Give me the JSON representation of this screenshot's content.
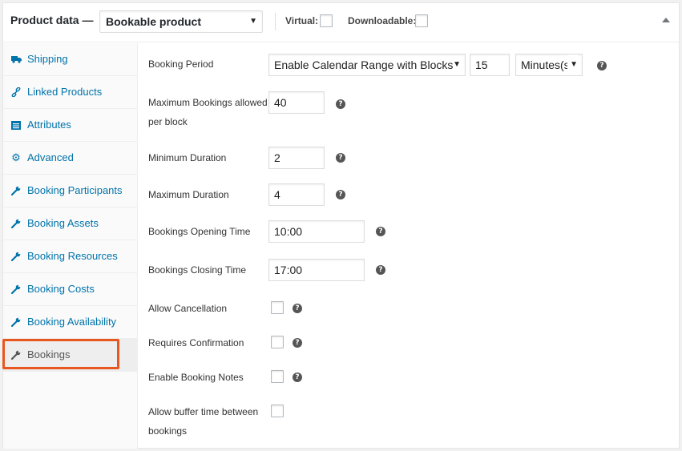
{
  "header": {
    "title": "Product data —",
    "product_type": "Bookable product",
    "virtual_label": "Virtual:",
    "downloadable_label": "Downloadable:"
  },
  "sidebar": {
    "items": [
      {
        "label": "Shipping",
        "icon": "truck-icon"
      },
      {
        "label": "Linked Products",
        "icon": "link-icon"
      },
      {
        "label": "Attributes",
        "icon": "list-icon"
      },
      {
        "label": "Advanced",
        "icon": "gear-icon"
      },
      {
        "label": "Booking Participants",
        "icon": "wrench-icon"
      },
      {
        "label": "Booking Assets",
        "icon": "wrench-icon"
      },
      {
        "label": "Booking Resources",
        "icon": "wrench-icon"
      },
      {
        "label": "Booking Costs",
        "icon": "wrench-icon"
      },
      {
        "label": "Booking Availability",
        "icon": "wrench-icon"
      },
      {
        "label": "Bookings",
        "icon": "wrench-icon",
        "active": true
      }
    ]
  },
  "fields": {
    "booking_period_label": "Booking Period",
    "booking_period_mode": "Enable Calendar Range with Blocks",
    "booking_period_value": "15",
    "booking_period_unit": "Minutes(s",
    "max_bookings_label_1": "Maximum Bookings allowed",
    "max_bookings_label_2": "per block",
    "max_bookings_value": "40",
    "min_duration_label": "Minimum Duration",
    "min_duration_value": "2",
    "max_duration_label": "Maximum Duration",
    "max_duration_value": "4",
    "opening_time_label": "Bookings Opening Time",
    "opening_time_value": "10:00",
    "closing_time_label": "Bookings Closing Time",
    "closing_time_value": "17:00",
    "allow_cancellation_label": "Allow Cancellation",
    "requires_confirmation_label": "Requires Confirmation",
    "enable_notes_label": "Enable Booking Notes",
    "buffer_label_1": "Allow buffer time between",
    "buffer_label_2": "bookings"
  },
  "help_glyph": "?",
  "colors": {
    "accent": "#0073aa",
    "highlight_border": "#e8571f",
    "active_tab_bg": "#eeeeee"
  }
}
